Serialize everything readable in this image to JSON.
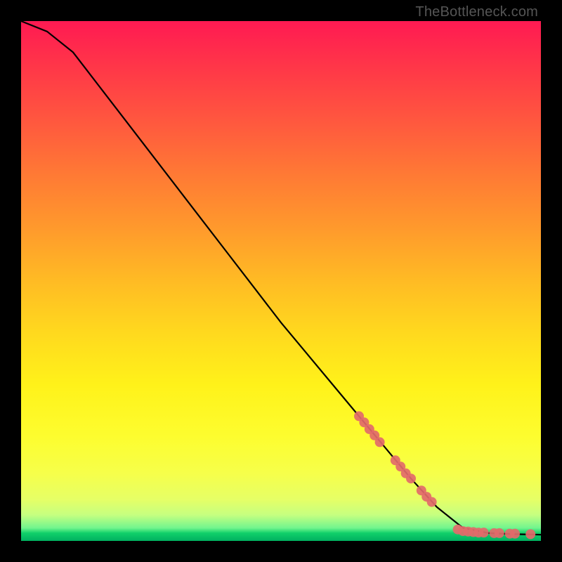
{
  "watermark": {
    "text": "TheBottleneck.com"
  },
  "chart_data": {
    "type": "line",
    "title": "",
    "xlabel": "",
    "ylabel": "",
    "xlim": [
      0,
      100
    ],
    "ylim": [
      0,
      100
    ],
    "grid": false,
    "annotations": [
      "TheBottleneck.com"
    ],
    "series": [
      {
        "name": "curve",
        "x": [
          0,
          5,
          10,
          15,
          20,
          25,
          30,
          35,
          40,
          45,
          50,
          55,
          60,
          65,
          70,
          75,
          80,
          85,
          90,
          95,
          100
        ],
        "y": [
          100,
          98,
          94,
          87.5,
          81,
          74.5,
          68,
          61.5,
          55,
          48.5,
          42,
          36,
          30,
          24,
          18,
          12,
          6.5,
          2.5,
          1.5,
          1.3,
          1.2
        ]
      },
      {
        "name": "markers",
        "x": [
          65,
          66,
          67,
          68,
          69,
          72,
          73,
          74,
          75,
          77,
          78,
          79,
          84,
          85,
          86,
          87,
          88,
          89,
          91,
          92,
          94,
          95,
          98
        ],
        "y": [
          24,
          22.8,
          21.5,
          20.3,
          19,
          15.5,
          14.3,
          13,
          12,
          9.7,
          8.5,
          7.5,
          2.2,
          1.9,
          1.8,
          1.7,
          1.6,
          1.6,
          1.5,
          1.5,
          1.4,
          1.4,
          1.3
        ]
      }
    ]
  }
}
